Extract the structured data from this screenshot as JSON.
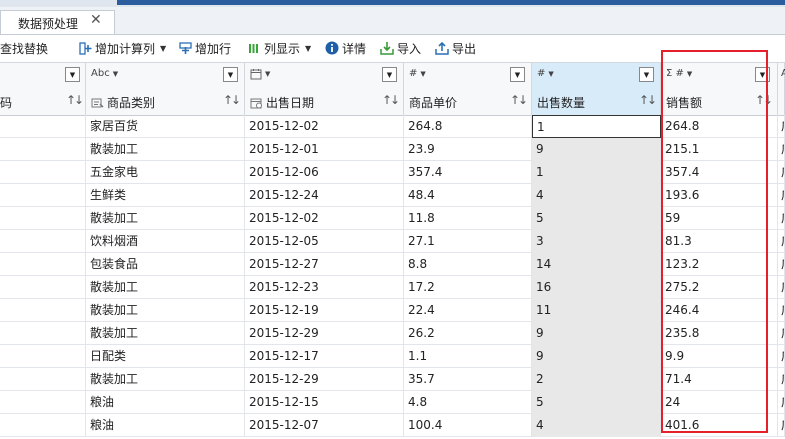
{
  "tabs": [
    {
      "label": "数据预处理",
      "close": "✕"
    }
  ],
  "toolbar": {
    "find_replace": "查找替换",
    "add_calc_col": "增加计算列",
    "add_row": "增加行",
    "col_display": "列显示",
    "details": "详情",
    "import": "导入",
    "export": "导出"
  },
  "columns": [
    {
      "type": "",
      "name": "码"
    },
    {
      "type": "Abc",
      "name": "商品类别",
      "icon": "category-icon"
    },
    {
      "type": "date",
      "name": "出售日期",
      "icon": "calendar-icon"
    },
    {
      "type": "#",
      "name": "商品单价"
    },
    {
      "type": "#",
      "name": "出售数量"
    },
    {
      "type": "Σ #",
      "name": "销售额"
    },
    {
      "type": "A",
      "name": ""
    }
  ],
  "rows": [
    {
      "category": "家居百货",
      "date": "2015-12-02",
      "price": "264.8",
      "qty": "1",
      "sales": "264.8"
    },
    {
      "category": "散装加工",
      "date": "2015-12-01",
      "price": "23.9",
      "qty": "9",
      "sales": "215.1"
    },
    {
      "category": "五金家电",
      "date": "2015-12-06",
      "price": "357.4",
      "qty": "1",
      "sales": "357.4"
    },
    {
      "category": "生鲜类",
      "date": "2015-12-24",
      "price": "48.4",
      "qty": "4",
      "sales": "193.6"
    },
    {
      "category": "散装加工",
      "date": "2015-12-02",
      "price": "11.8",
      "qty": "5",
      "sales": "59"
    },
    {
      "category": "饮料烟酒",
      "date": "2015-12-05",
      "price": "27.1",
      "qty": "3",
      "sales": "81.3"
    },
    {
      "category": "包装食品",
      "date": "2015-12-27",
      "price": "8.8",
      "qty": "14",
      "sales": "123.2"
    },
    {
      "category": "散装加工",
      "date": "2015-12-23",
      "price": "17.2",
      "qty": "16",
      "sales": "275.2"
    },
    {
      "category": "散装加工",
      "date": "2015-12-19",
      "price": "22.4",
      "qty": "11",
      "sales": "246.4"
    },
    {
      "category": "散装加工",
      "date": "2015-12-29",
      "price": "26.2",
      "qty": "9",
      "sales": "235.8"
    },
    {
      "category": "日配类",
      "date": "2015-12-17",
      "price": "1.1",
      "qty": "9",
      "sales": "9.9"
    },
    {
      "category": "散装加工",
      "date": "2015-12-29",
      "price": "35.7",
      "qty": "2",
      "sales": "71.4"
    },
    {
      "category": "粮油",
      "date": "2015-12-15",
      "price": "4.8",
      "qty": "5",
      "sales": "24"
    },
    {
      "category": "粮油",
      "date": "2015-12-07",
      "price": "100.4",
      "qty": "4",
      "sales": "401.6"
    }
  ],
  "last_col_char": "广",
  "colors": {
    "accent": "#2b5d9e",
    "highlight": "#e4202a",
    "selected_header": "#d8ebf9"
  }
}
